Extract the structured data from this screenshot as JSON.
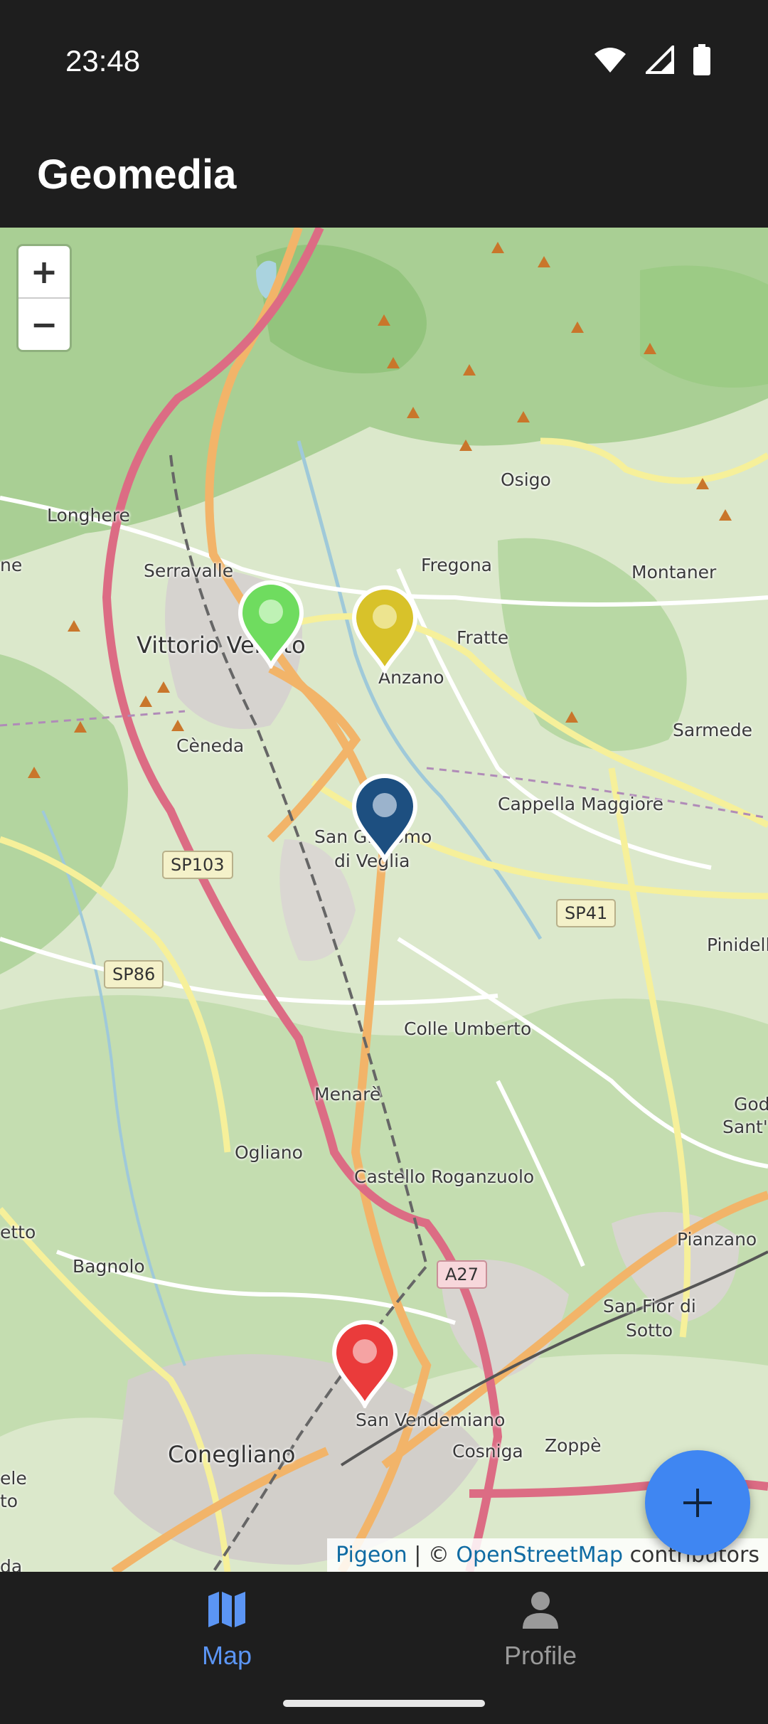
{
  "status_bar": {
    "time": "23:48",
    "icons": [
      "wifi-icon",
      "signal-icon",
      "battery-icon"
    ]
  },
  "app_bar": {
    "title": "Geomedia"
  },
  "map": {
    "zoom_in_label": "+",
    "zoom_out_label": "−",
    "places": {
      "osigo": "Osigo",
      "longhere": "Longhere",
      "ne": "ne",
      "serravalle": "Serravalle",
      "fregona": "Fregona",
      "montaner": "Montaner",
      "vittorio_veneto": "Vittorio Veneto",
      "fratte": "Fratte",
      "anzano": "Anzano",
      "sarmede": "Sarmede",
      "ceneda": "Cèneda",
      "cappella_maggiore": "Cappella Maggiore",
      "san_giacomo": "San Giacomo",
      "di_veglia": "di Veglia",
      "pinidello": "Pinidell",
      "colle_umberto": "Colle Umberto",
      "menare": "Menarè",
      "god": "God",
      "sant": "Sant'",
      "ogliano": "Ogliano",
      "castello_roganzuolo": "Castello Roganzuolo",
      "etto": "etto",
      "pianzano": "Pianzano",
      "bagnolo": "Bagnolo",
      "san_fior_di": "San Fior di",
      "sotto": "Sotto",
      "san_vendemiano": "San Vendemiano",
      "conegliano": "Conegliano",
      "cosniga": "Cosniga",
      "zoppe": "Zoppè",
      "ele": "ele",
      "to": "to",
      "da": "da"
    },
    "road_shields": {
      "sp103": "SP103",
      "sp41": "SP41",
      "sp86": "SP86",
      "a27": "A27"
    },
    "markers": [
      {
        "name": "marker-green",
        "color": "#6fdc5f"
      },
      {
        "name": "marker-yellow",
        "color": "#d8c22a"
      },
      {
        "name": "marker-blue",
        "color": "#1d4f80"
      },
      {
        "name": "marker-red",
        "color": "#ea3b3b"
      }
    ],
    "attribution": {
      "link1": "Pigeon",
      "sep": " | © ",
      "link2": "OpenStreetMap",
      "suffix": " contributors"
    }
  },
  "fab": {
    "icon": "add-icon"
  },
  "bottom_nav": {
    "items": [
      {
        "label": "Map",
        "icon": "map-icon",
        "active": true
      },
      {
        "label": "Profile",
        "icon": "person-icon",
        "active": false
      }
    ]
  },
  "colors": {
    "accent": "#5b95f4",
    "fab": "#3f86f2",
    "bar": "#1e1e1e"
  }
}
